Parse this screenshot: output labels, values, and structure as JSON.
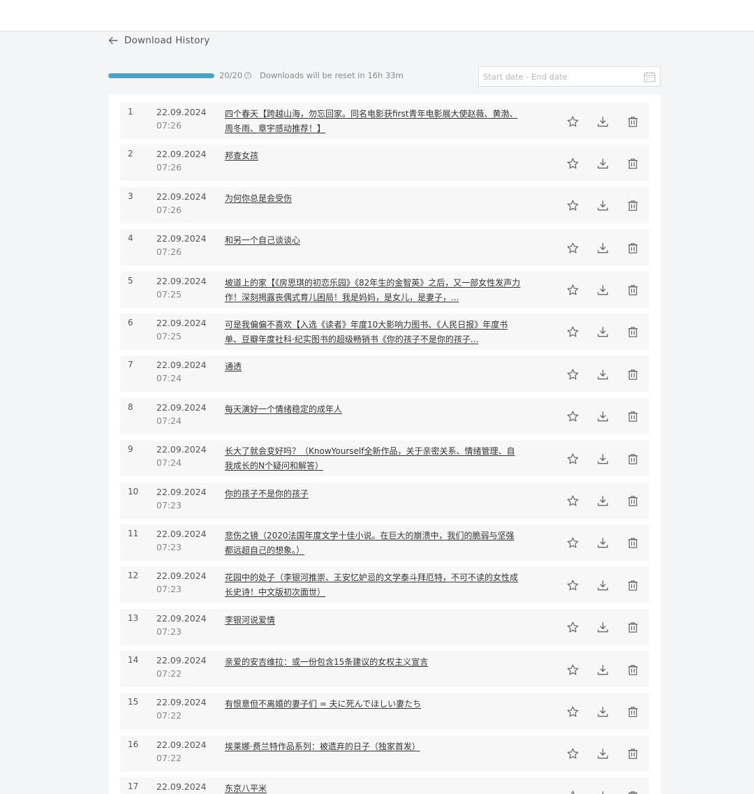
{
  "header": {
    "title": "Download History"
  },
  "quota": {
    "count": "20/20",
    "used": 20,
    "total": 20,
    "reset_text": "Downloads will be reset in 16h 33m"
  },
  "filter": {
    "date_placeholder": "Start date - End date"
  },
  "colors": {
    "accent": "#4aa3c7",
    "background": "#f4f5f6",
    "row": "#f7f7f8"
  },
  "icons": [
    "back-arrow-icon",
    "help-icon",
    "calendar-icon",
    "star-icon",
    "download-icon",
    "trash-icon"
  ],
  "rows": [
    {
      "num": "1",
      "date": "22.09.2024",
      "time": "07:26",
      "title": "四个春天【跨越山海，勿忘回家。同名电影获first青年电影展大使赵薇、黄渤、周冬雨、章宇感动推荐！】"
    },
    {
      "num": "2",
      "date": "22.09.2024",
      "time": "07:26",
      "title": "邦查女孩"
    },
    {
      "num": "3",
      "date": "22.09.2024",
      "time": "07:26",
      "title": "为何你总是会受伤"
    },
    {
      "num": "4",
      "date": "22.09.2024",
      "time": "07:26",
      "title": "和另一个自己谈谈心"
    },
    {
      "num": "5",
      "date": "22.09.2024",
      "time": "07:25",
      "title": "坡道上的家【《房思琪的初恋乐园》《82年生的金智英》之后，又一部女性发声力作！深刻揭露丧偶式育儿困局！我是妈妈，是女儿，是妻子，..."
    },
    {
      "num": "6",
      "date": "22.09.2024",
      "time": "07:25",
      "title": "可是我偏偏不喜欢【入选《读者》年度10大影响力图书、《人民日报》年度书单、豆瓣年度社科·纪实图书的超级畅销书《你的孩子不是你的孩子..."
    },
    {
      "num": "7",
      "date": "22.09.2024",
      "time": "07:24",
      "title": "通透"
    },
    {
      "num": "8",
      "date": "22.09.2024",
      "time": "07:24",
      "title": "每天演好一个情绪稳定的成年人"
    },
    {
      "num": "9",
      "date": "22.09.2024",
      "time": "07:24",
      "title": "长大了就会变好吗？（KnowYourself全新作品，关于亲密关系、情绪管理、自我成长的N个疑问和解答）"
    },
    {
      "num": "10",
      "date": "22.09.2024",
      "time": "07:23",
      "title": "你的孩子不是你的孩子"
    },
    {
      "num": "11",
      "date": "22.09.2024",
      "time": "07:23",
      "title": "悲伤之镜（2020法国年度文学十佳小说。在巨大的崩溃中，我们的脆弱与坚强都远超自己的想象。）"
    },
    {
      "num": "12",
      "date": "22.09.2024",
      "time": "07:23",
      "title": "花园中的处子（李银河推崇、王安忆妒忌的文学泰斗拜厄特，不可不读的女性成长史诗！中文版初次面世）"
    },
    {
      "num": "13",
      "date": "22.09.2024",
      "time": "07:23",
      "title": "李银河说爱情"
    },
    {
      "num": "14",
      "date": "22.09.2024",
      "time": "07:22",
      "title": "亲爱的安吉维拉：或一份包含15条建议的女权主义宣言"
    },
    {
      "num": "15",
      "date": "22.09.2024",
      "time": "07:22",
      "title": "有恨意但不离婚的妻子们 = 夫に死んでほしい妻たち"
    },
    {
      "num": "16",
      "date": "22.09.2024",
      "time": "07:22",
      "title": "埃莱娜·费兰特作品系列：被遗弃的日子（独家首发）"
    },
    {
      "num": "17",
      "date": "22.09.2024",
      "time": "",
      "title": "东京八平米"
    }
  ]
}
